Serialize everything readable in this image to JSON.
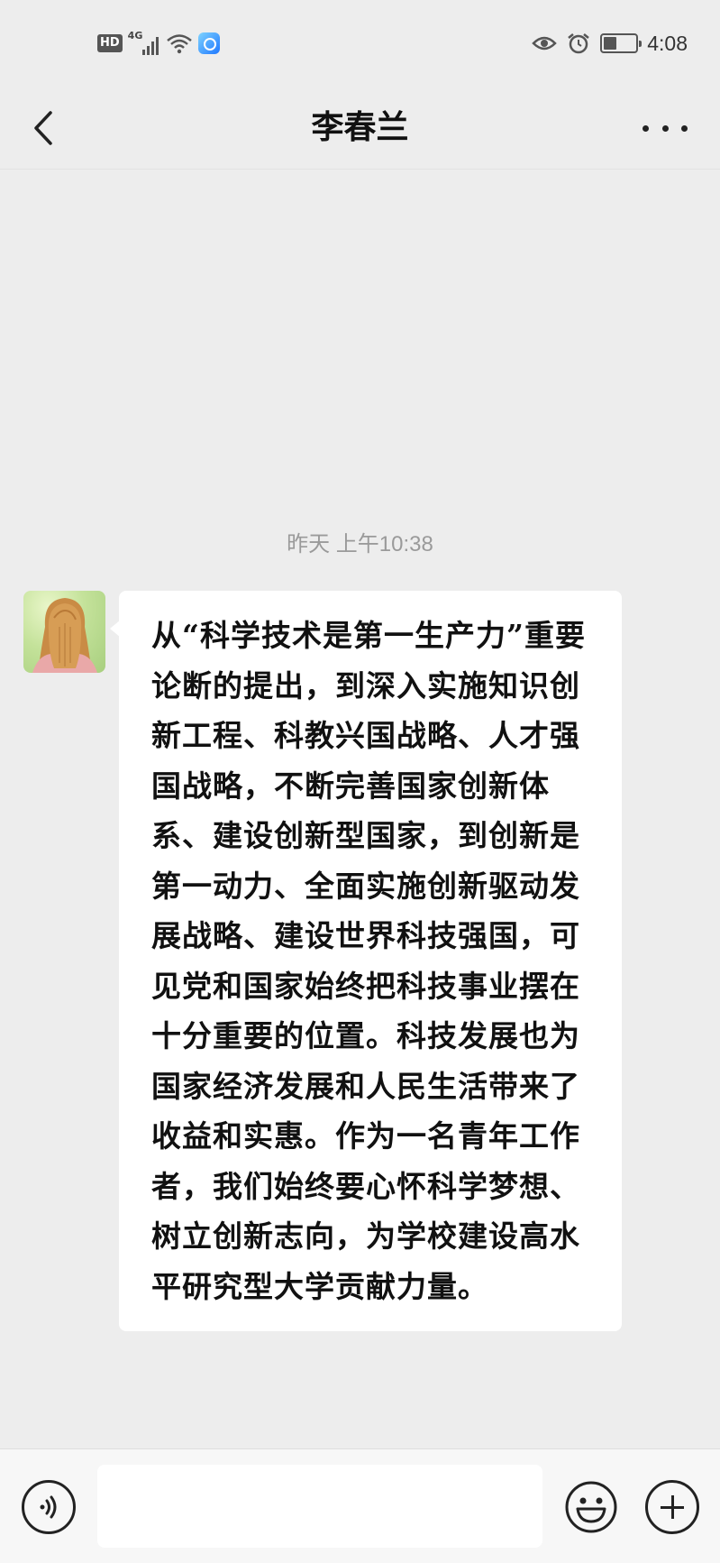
{
  "status_bar": {
    "hd_label": "HD",
    "network_label": "4G",
    "time": "4:08",
    "icons": [
      "hd-icon",
      "signal-icon",
      "wifi-icon",
      "app-notification-icon",
      "eye-icon",
      "alarm-icon",
      "battery-icon"
    ]
  },
  "nav": {
    "title": "李春兰",
    "back_icon": "chevron-left-icon",
    "more_icon": "more-dots-icon"
  },
  "chat": {
    "timestamp": "昨天 上午10:38",
    "messages": [
      {
        "side": "left",
        "avatar": "contact-avatar",
        "text": "从“科学技术是第一生产力”重要论断的提出，到深入实施知识创新工程、科教兴国战略、人才强国战略，不断完善国家创新体系、建设创新型国家，到创新是第一动力、全面实施创新驱动发展战略、建设世界科技强国，可见党和国家始终把科技事业摆在十分重要的位置。科技发展也为国家经济发展和人民生活带来了收益和实惠。作为一名青年工作者，我们始终要心怀科学梦想、树立创新志向，为学校建设高水平研究型大学贡献力量。"
      }
    ]
  },
  "input_bar": {
    "input_value": "",
    "voice_icon": "voice-icon",
    "emoji_icon": "emoji-icon",
    "plus_icon": "plus-icon"
  }
}
